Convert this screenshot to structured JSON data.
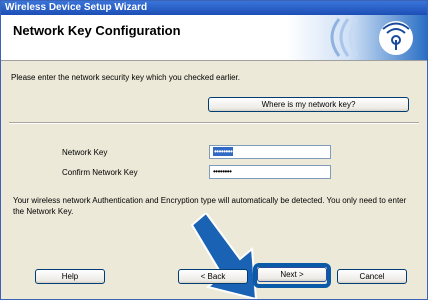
{
  "window": {
    "title": "Wireless Device Setup Wizard"
  },
  "header": {
    "page_title": "Network Key Configuration"
  },
  "intro": "Please enter the network security key which you checked earlier.",
  "where_button_label": "Where is my network key?",
  "form": {
    "network_key_label": "Network Key",
    "network_key_value": "••••••••",
    "confirm_key_label": "Confirm Network Key",
    "confirm_key_value": "••••••••"
  },
  "note": "Your wireless network Authentication and Encryption type will automatically be detected. You only need to enter the Network Key.",
  "footer": {
    "help_label": "Help",
    "back_label": "< Back",
    "next_label": "Next >",
    "cancel_label": "Cancel"
  },
  "colors": {
    "titlebar": "#1c4fb5",
    "accent": "#1a62b4",
    "selection": "#316ac5"
  },
  "icons": {
    "logo": "wifi-signal-icon",
    "arrow": "arrow-down-right-icon"
  }
}
